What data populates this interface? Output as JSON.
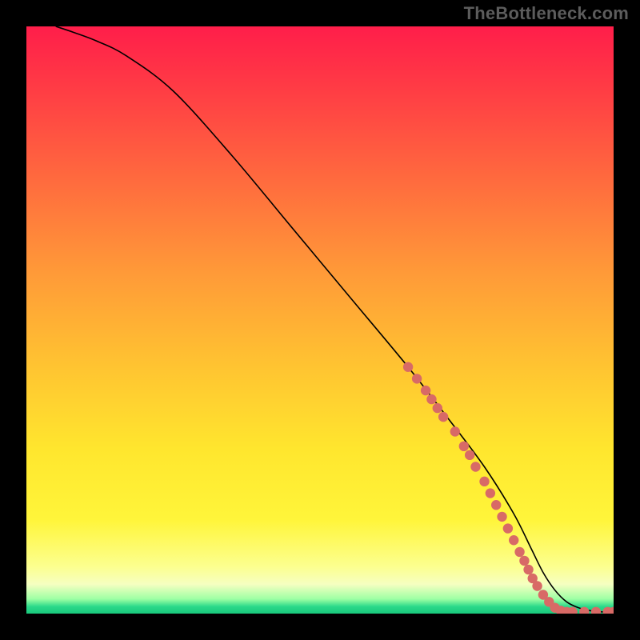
{
  "watermark": "TheBottleneck.com",
  "chart_data": {
    "type": "line",
    "title": "",
    "xlabel": "",
    "ylabel": "",
    "xlim": [
      0,
      100
    ],
    "ylim": [
      0,
      100
    ],
    "series": [
      {
        "name": "curve",
        "x": [
          5,
          8,
          12,
          17,
          25,
          35,
          45,
          55,
          65,
          72,
          78,
          83,
          86,
          88,
          90,
          92,
          94,
          96,
          98,
          100
        ],
        "y": [
          100,
          99,
          97.5,
          95,
          89,
          78,
          66,
          54,
          42,
          33,
          25,
          17,
          11,
          7,
          4,
          2,
          1,
          0.5,
          0.3,
          0.3
        ]
      }
    ],
    "points": [
      {
        "x": 65,
        "y": 42
      },
      {
        "x": 66.5,
        "y": 40
      },
      {
        "x": 68,
        "y": 38
      },
      {
        "x": 69,
        "y": 36.5
      },
      {
        "x": 70,
        "y": 35
      },
      {
        "x": 71,
        "y": 33.5
      },
      {
        "x": 73,
        "y": 31
      },
      {
        "x": 74.5,
        "y": 28.5
      },
      {
        "x": 75.5,
        "y": 27
      },
      {
        "x": 76.5,
        "y": 25
      },
      {
        "x": 78,
        "y": 22.5
      },
      {
        "x": 79,
        "y": 20.5
      },
      {
        "x": 80,
        "y": 18.5
      },
      {
        "x": 81,
        "y": 16.5
      },
      {
        "x": 82,
        "y": 14.5
      },
      {
        "x": 83,
        "y": 12.5
      },
      {
        "x": 84,
        "y": 10.5
      },
      {
        "x": 84.8,
        "y": 9
      },
      {
        "x": 85.5,
        "y": 7.5
      },
      {
        "x": 86.2,
        "y": 6
      },
      {
        "x": 87,
        "y": 4.7
      },
      {
        "x": 88,
        "y": 3.2
      },
      {
        "x": 89,
        "y": 2
      },
      {
        "x": 90,
        "y": 1
      },
      {
        "x": 91,
        "y": 0.5
      },
      {
        "x": 92,
        "y": 0.3
      },
      {
        "x": 93,
        "y": 0.3
      },
      {
        "x": 95,
        "y": 0.3
      },
      {
        "x": 97,
        "y": 0.3
      },
      {
        "x": 99,
        "y": 0.3
      },
      {
        "x": 100,
        "y": 0.3
      }
    ],
    "colors": {
      "curve": "#000000",
      "points": "#d86a66",
      "gradient_top": "#ff1e4a",
      "gradient_mid": "#ffe62e",
      "gradient_bottom": "#19c87c"
    }
  }
}
